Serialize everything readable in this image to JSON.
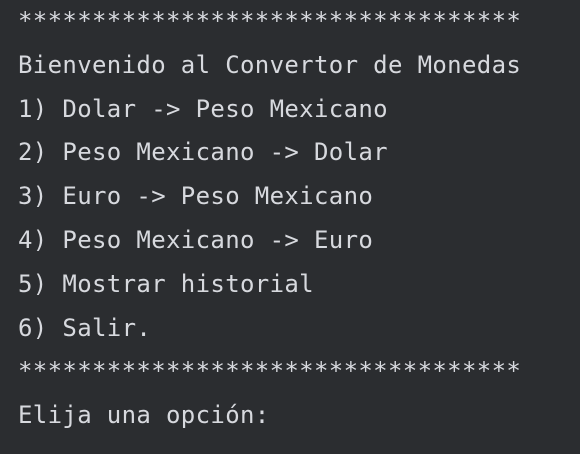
{
  "console": {
    "top_border": "**********************************",
    "welcome": "Bienvenido al Convertor de Monedas",
    "options": [
      "1) Dolar -> Peso Mexicano",
      "2) Peso Mexicano -> Dolar",
      "3) Euro -> Peso Mexicano",
      "4) Peso Mexicano -> Euro",
      "5) Mostrar historial",
      "6) Salir."
    ],
    "bottom_border": "**********************************",
    "prompt": "Elija una opción:"
  },
  "colors": {
    "background": "#2b2d30",
    "text": "#d7d9de"
  }
}
